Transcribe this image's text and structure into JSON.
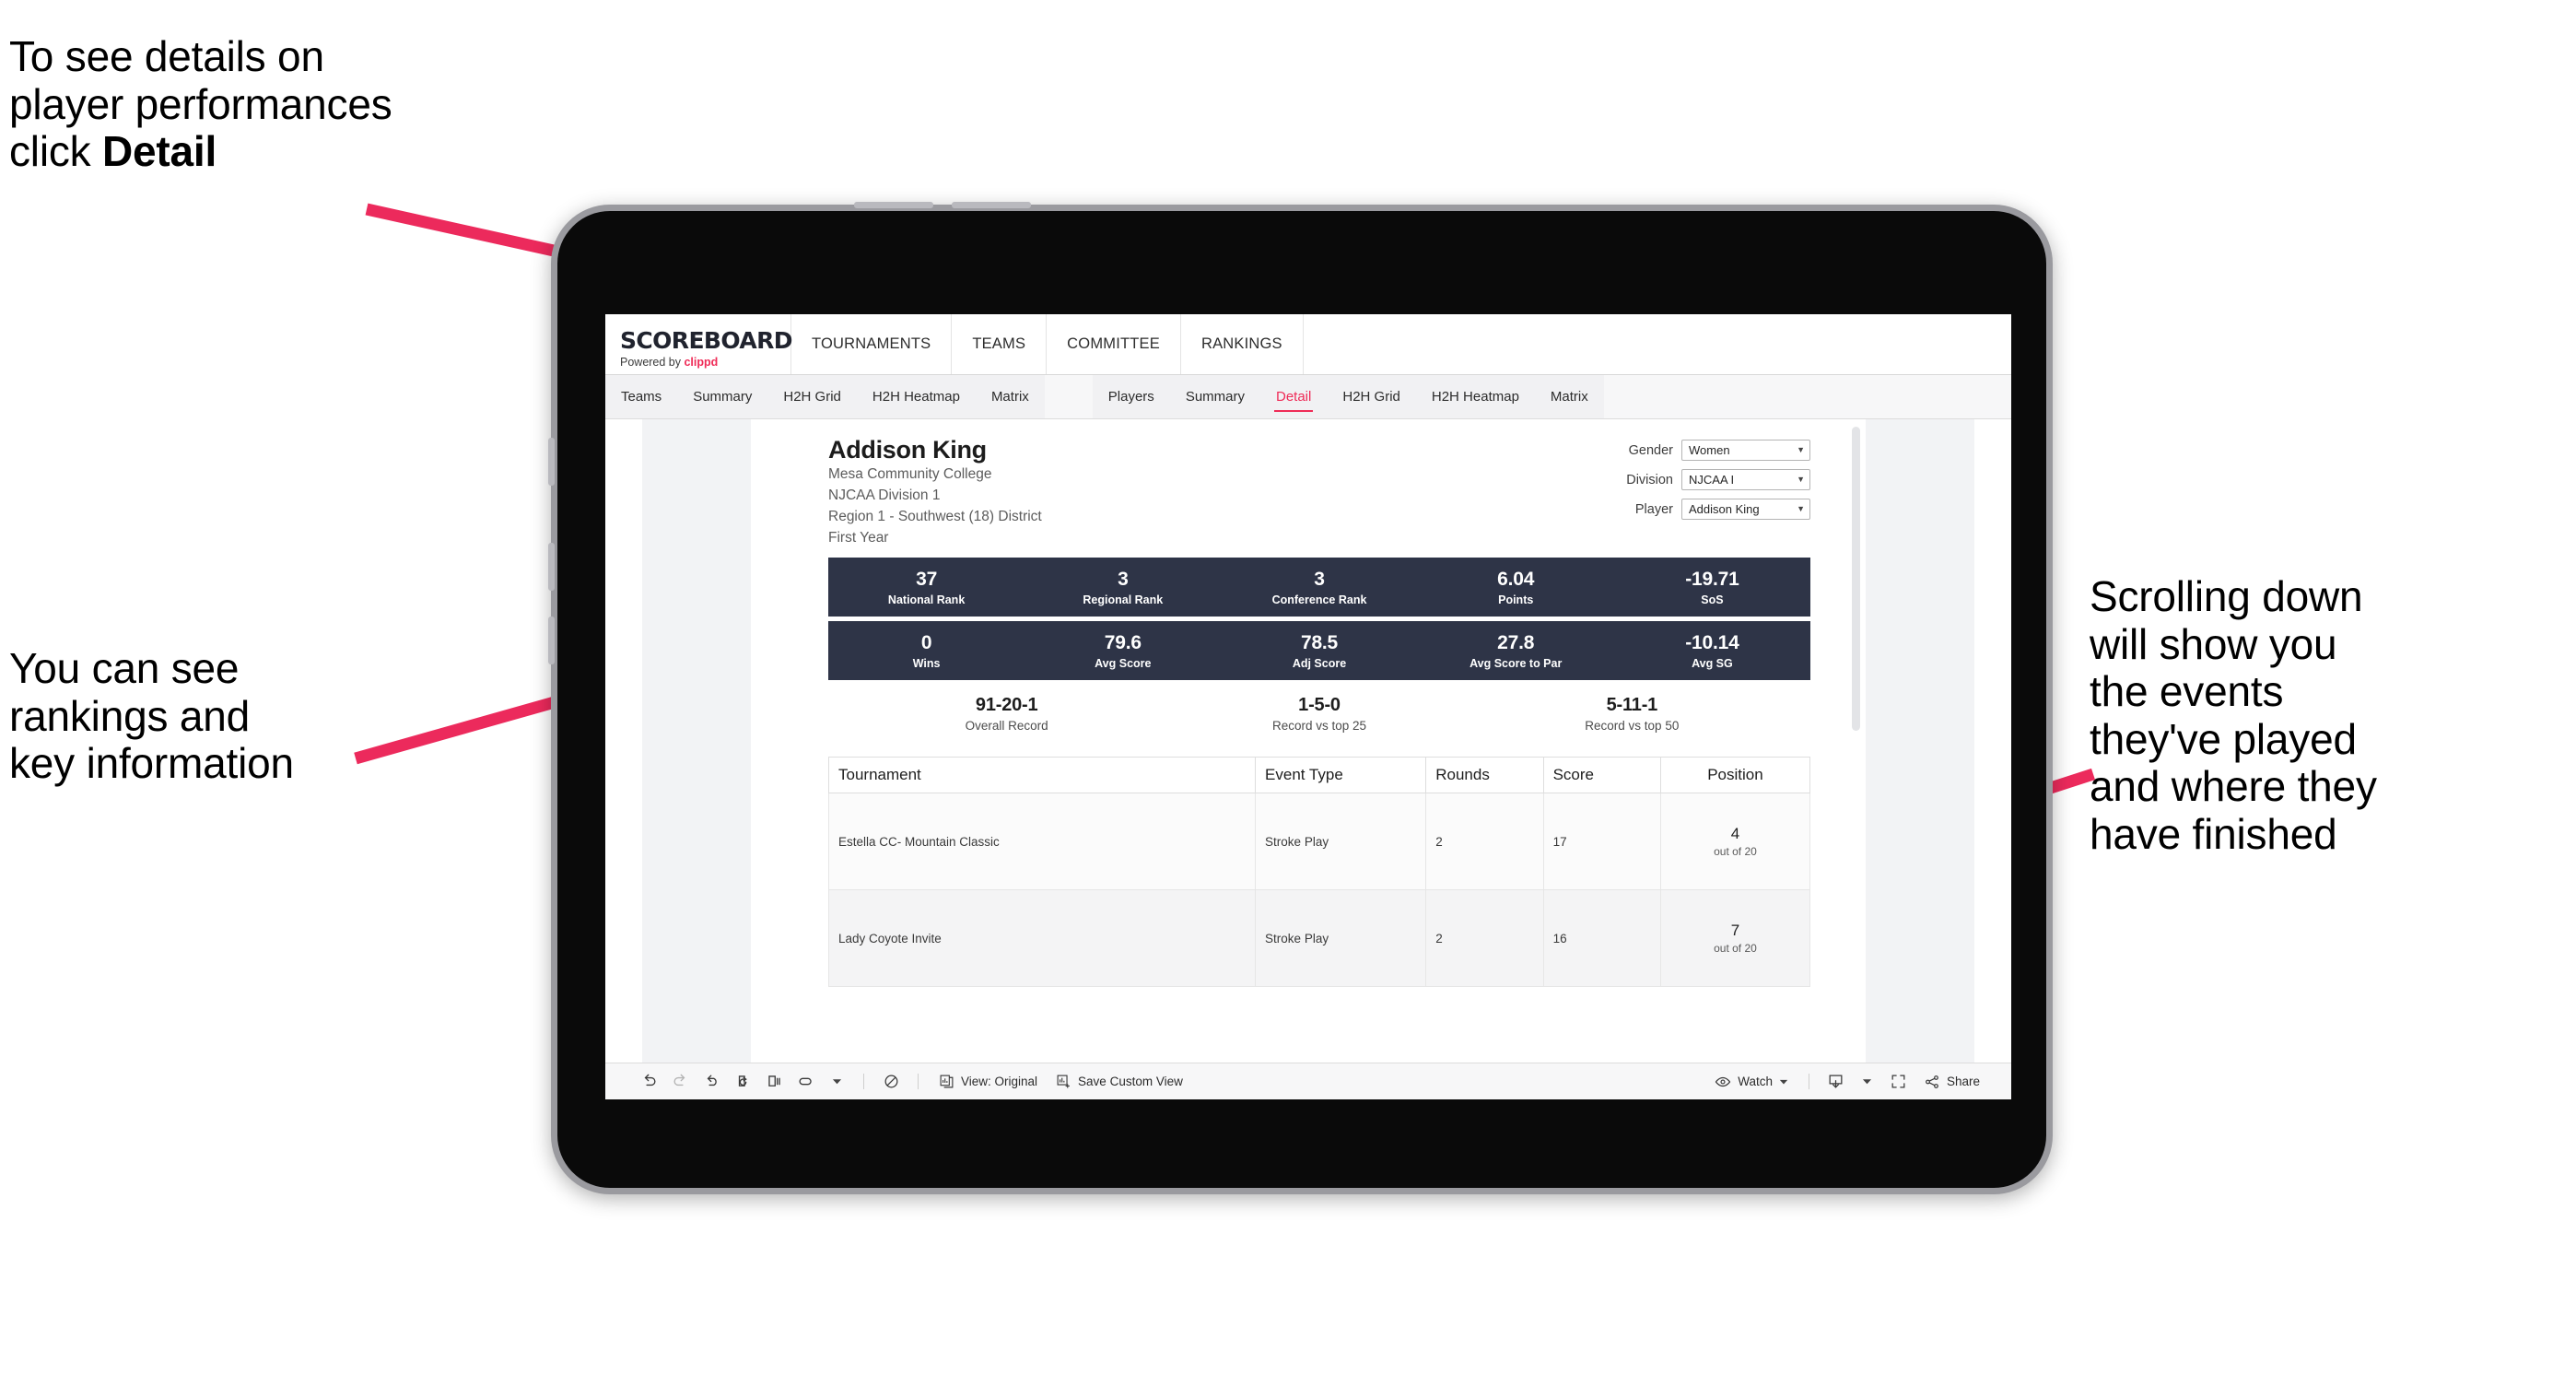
{
  "annotations": {
    "top_left": "To see details on\nplayer performances\nclick ",
    "top_left_bold": "Detail",
    "bottom_left": "You can see\nrankings and\nkey information",
    "right": "Scrolling down\nwill show you\nthe events\nthey've played\nand where they\nhave finished"
  },
  "colors": {
    "accent_pink": "#ef2b57",
    "stat_navy": "#2e3447",
    "arrow_pink": "#ec2a5c"
  },
  "app": {
    "logo": {
      "main": "SCOREBOARD",
      "powered_prefix": "Powered by ",
      "brand": "clippd"
    },
    "top_nav": [
      "TOURNAMENTS",
      "TEAMS",
      "COMMITTEE",
      "RANKINGS"
    ],
    "tab_groups": [
      {
        "head": "Teams",
        "tabs": [
          {
            "label": "Summary",
            "active": false
          },
          {
            "label": "H2H Grid",
            "active": false
          },
          {
            "label": "H2H Heatmap",
            "active": false
          },
          {
            "label": "Matrix",
            "active": false
          }
        ]
      },
      {
        "head": "Players",
        "tabs": [
          {
            "label": "Summary",
            "active": false
          },
          {
            "label": "Detail",
            "active": true
          },
          {
            "label": "H2H Grid",
            "active": false
          },
          {
            "label": "H2H Heatmap",
            "active": false
          },
          {
            "label": "Matrix",
            "active": false
          }
        ]
      }
    ]
  },
  "player": {
    "name": "Addison King",
    "school": "Mesa Community College",
    "division": "NJCAA Division 1",
    "region": "Region 1 - Southwest (18) District",
    "year": "First Year"
  },
  "filters": [
    {
      "label": "Gender",
      "value": "Women"
    },
    {
      "label": "Division",
      "value": "NJCAA I"
    },
    {
      "label": "Player",
      "value": "Addison King"
    }
  ],
  "stats_row_1": [
    {
      "value": "37",
      "label": "National Rank"
    },
    {
      "value": "3",
      "label": "Regional Rank"
    },
    {
      "value": "3",
      "label": "Conference Rank"
    },
    {
      "value": "6.04",
      "label": "Points"
    },
    {
      "value": "-19.71",
      "label": "SoS"
    }
  ],
  "stats_row_2": [
    {
      "value": "0",
      "label": "Wins"
    },
    {
      "value": "79.6",
      "label": "Avg Score"
    },
    {
      "value": "78.5",
      "label": "Adj Score"
    },
    {
      "value": "27.8",
      "label": "Avg Score to Par"
    },
    {
      "value": "-10.14",
      "label": "Avg SG"
    }
  ],
  "records": [
    {
      "value": "91-20-1",
      "label": "Overall Record"
    },
    {
      "value": "1-5-0",
      "label": "Record vs top 25"
    },
    {
      "value": "5-11-1",
      "label": "Record vs top 50"
    }
  ],
  "table": {
    "headers": [
      "Tournament",
      "Event Type",
      "Rounds",
      "Score",
      "Position"
    ],
    "rows": [
      {
        "tournament": "Estella CC- Mountain Classic",
        "event_type": "Stroke Play",
        "rounds": "2",
        "score": "17",
        "position": "4",
        "position_sub": "out of 20"
      },
      {
        "tournament": "Lady Coyote Invite",
        "event_type": "Stroke Play",
        "rounds": "2",
        "score": "16",
        "position": "7",
        "position_sub": "out of 20"
      }
    ]
  },
  "toolbar": {
    "view_label": "View: Original",
    "save_label": "Save Custom View",
    "watch_label": "Watch",
    "share_label": "Share"
  }
}
